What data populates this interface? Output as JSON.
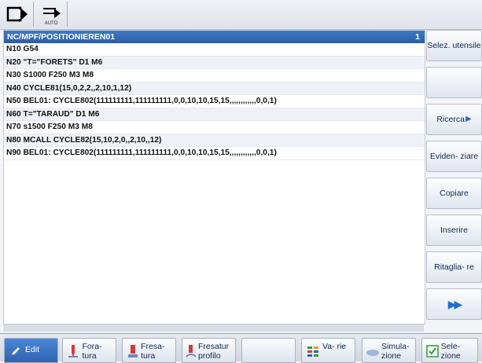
{
  "topbar": {
    "auto_label": "AUTO"
  },
  "editor": {
    "path": "NC/MPF/POSITIONIEREN01",
    "line_number": "1",
    "lines": [
      "N10 G54",
      "N20 \"T=\"FORETS\" D1 M6",
      "N30 S1000 F250 M3 M8",
      "N40 CYCLE81(15,0,2,2,,2,10,1,12)",
      "N50 BEL01: CYCLE802(111111111,111111111,0,0,10,10,15,15,,,,,,,,,,,,0,0,1)",
      "N60 T=\"TARAUD\" D1 M6",
      "N70 s1500 F250 M3 M8",
      "N80 MCALL CYCLE82(15,10,2,0,,2,10,,12)",
      "N90 BEL01: CYCLE802(111111111,111111111,0,0,10,10,15,15,,,,,,,,,,,,0,0,1)"
    ]
  },
  "softkeys": {
    "selez": "Selez. utensile",
    "ricerca": "Ricerca",
    "evidenziare": "Eviden- ziare",
    "copiare": "Copiare",
    "inserire": "Inserire",
    "ritagliare": "Ritaglia- re"
  },
  "hkeys": {
    "edit": "Edit",
    "foratura": "Fora- tura",
    "fresatura": "Fresa- tura",
    "fresatur_profilo": "Fresatur profilo",
    "varie": "Va- rie",
    "simulazione": "Simula- zione",
    "selezione": "Sele- zione"
  },
  "colors": {
    "accent": "#2b5ea8",
    "arrow": "#1f6fd0"
  }
}
